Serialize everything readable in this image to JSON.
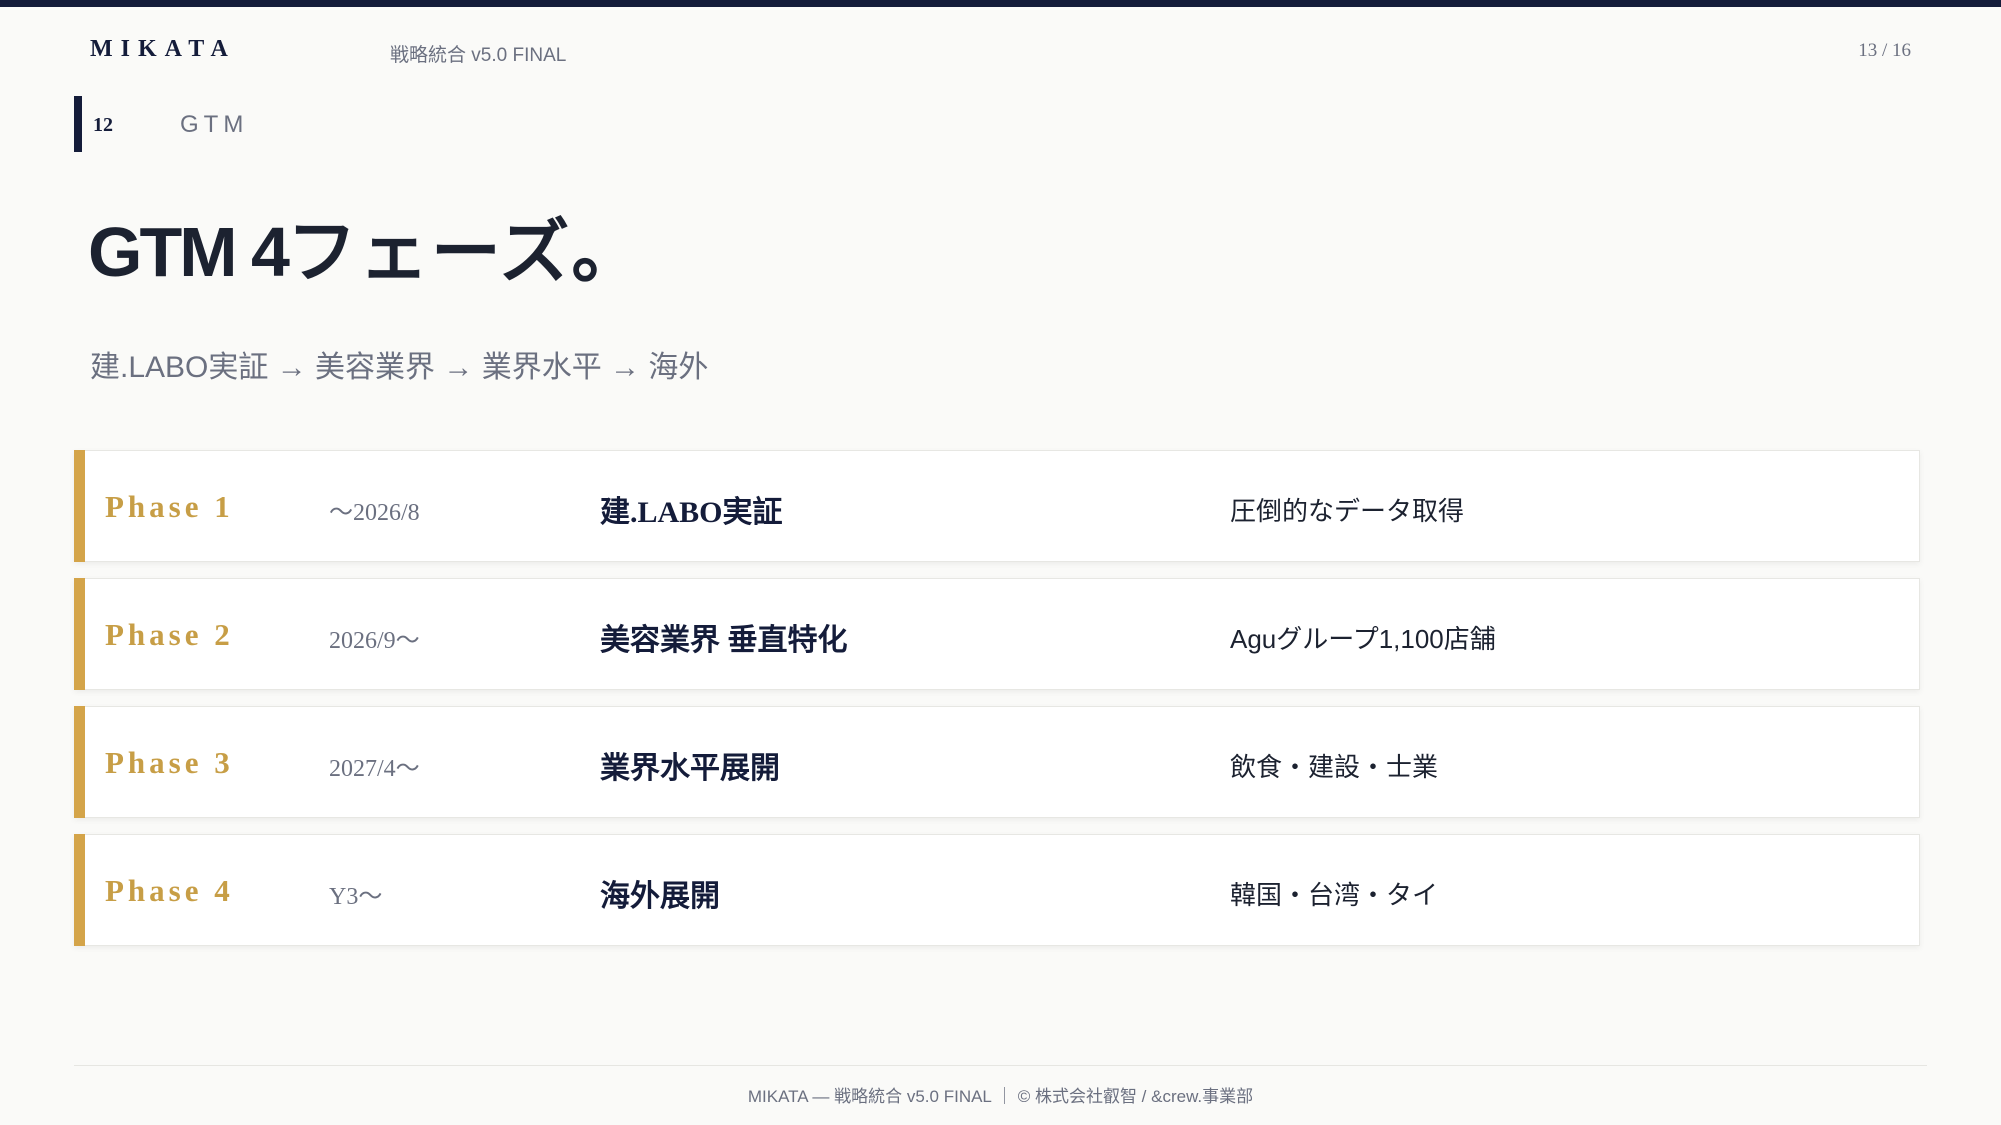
{
  "header": {
    "brand": "MIKATA",
    "doc_title": "戦略統合 v5.0 FINAL",
    "page_indicator": "13 / 16"
  },
  "section": {
    "number": "12",
    "label": "GTM"
  },
  "title": {
    "latin": "GTM 4",
    "jp": "フェーズ。"
  },
  "subtitle": "建.LABO実証 → 美容業界 → 業界水平 → 海外",
  "phases": [
    {
      "label": "Phase 1",
      "period": "〜2026/8",
      "name": "建.LABO実証",
      "desc": "圧倒的なデータ取得"
    },
    {
      "label": "Phase 2",
      "period": "2026/9〜",
      "name": "美容業界 垂直特化",
      "desc": "Aguグループ1,100店舗"
    },
    {
      "label": "Phase 3",
      "period": "2027/4〜",
      "name": "業界水平展開",
      "desc": "飲食・建設・士業"
    },
    {
      "label": "Phase 4",
      "period": "Y3〜",
      "name": "海外展開",
      "desc": "韓国・台湾・タイ"
    }
  ],
  "footer": "MIKATA — 戦略統合 v5.0 FINAL ｜ © 株式会社叡智 / &crew.事業部",
  "colors": {
    "navy": "#141c3a",
    "gold": "#d4a449",
    "background": "#fafaf8"
  }
}
